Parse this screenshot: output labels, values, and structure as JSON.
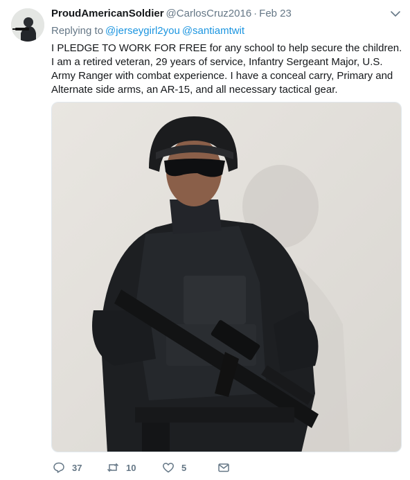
{
  "tweet": {
    "display_name": "ProudAmericanSoldier",
    "handle": "@CarlosCruz2016",
    "separator": "·",
    "timestamp": "Feb 23",
    "replying_to_label": "Replying to",
    "mentions": [
      "@jerseygirl2you",
      "@santiamtwit"
    ],
    "text": "I PLEDGE TO WORK FOR FREE for any school to help secure the children. I am a retired veteran, 29 years of service, Infantry Sergeant Major, U.S. Army Ranger with combat experience. I have a conceal carry, Primary and Alternate side arms, an AR-15, and all necessary tactical gear."
  },
  "media": {
    "icon": "photo-of-man-in-tactical-gear"
  },
  "actions": {
    "reply_count": "37",
    "retweet_count": "10",
    "like_count": "5"
  },
  "icons": {
    "caret": "chevron-down-icon",
    "reply": "reply-icon",
    "retweet": "retweet-icon",
    "like": "heart-icon",
    "dm": "envelope-icon"
  },
  "colors": {
    "link": "#1b95e0",
    "muted": "#657786",
    "text": "#14171a"
  }
}
